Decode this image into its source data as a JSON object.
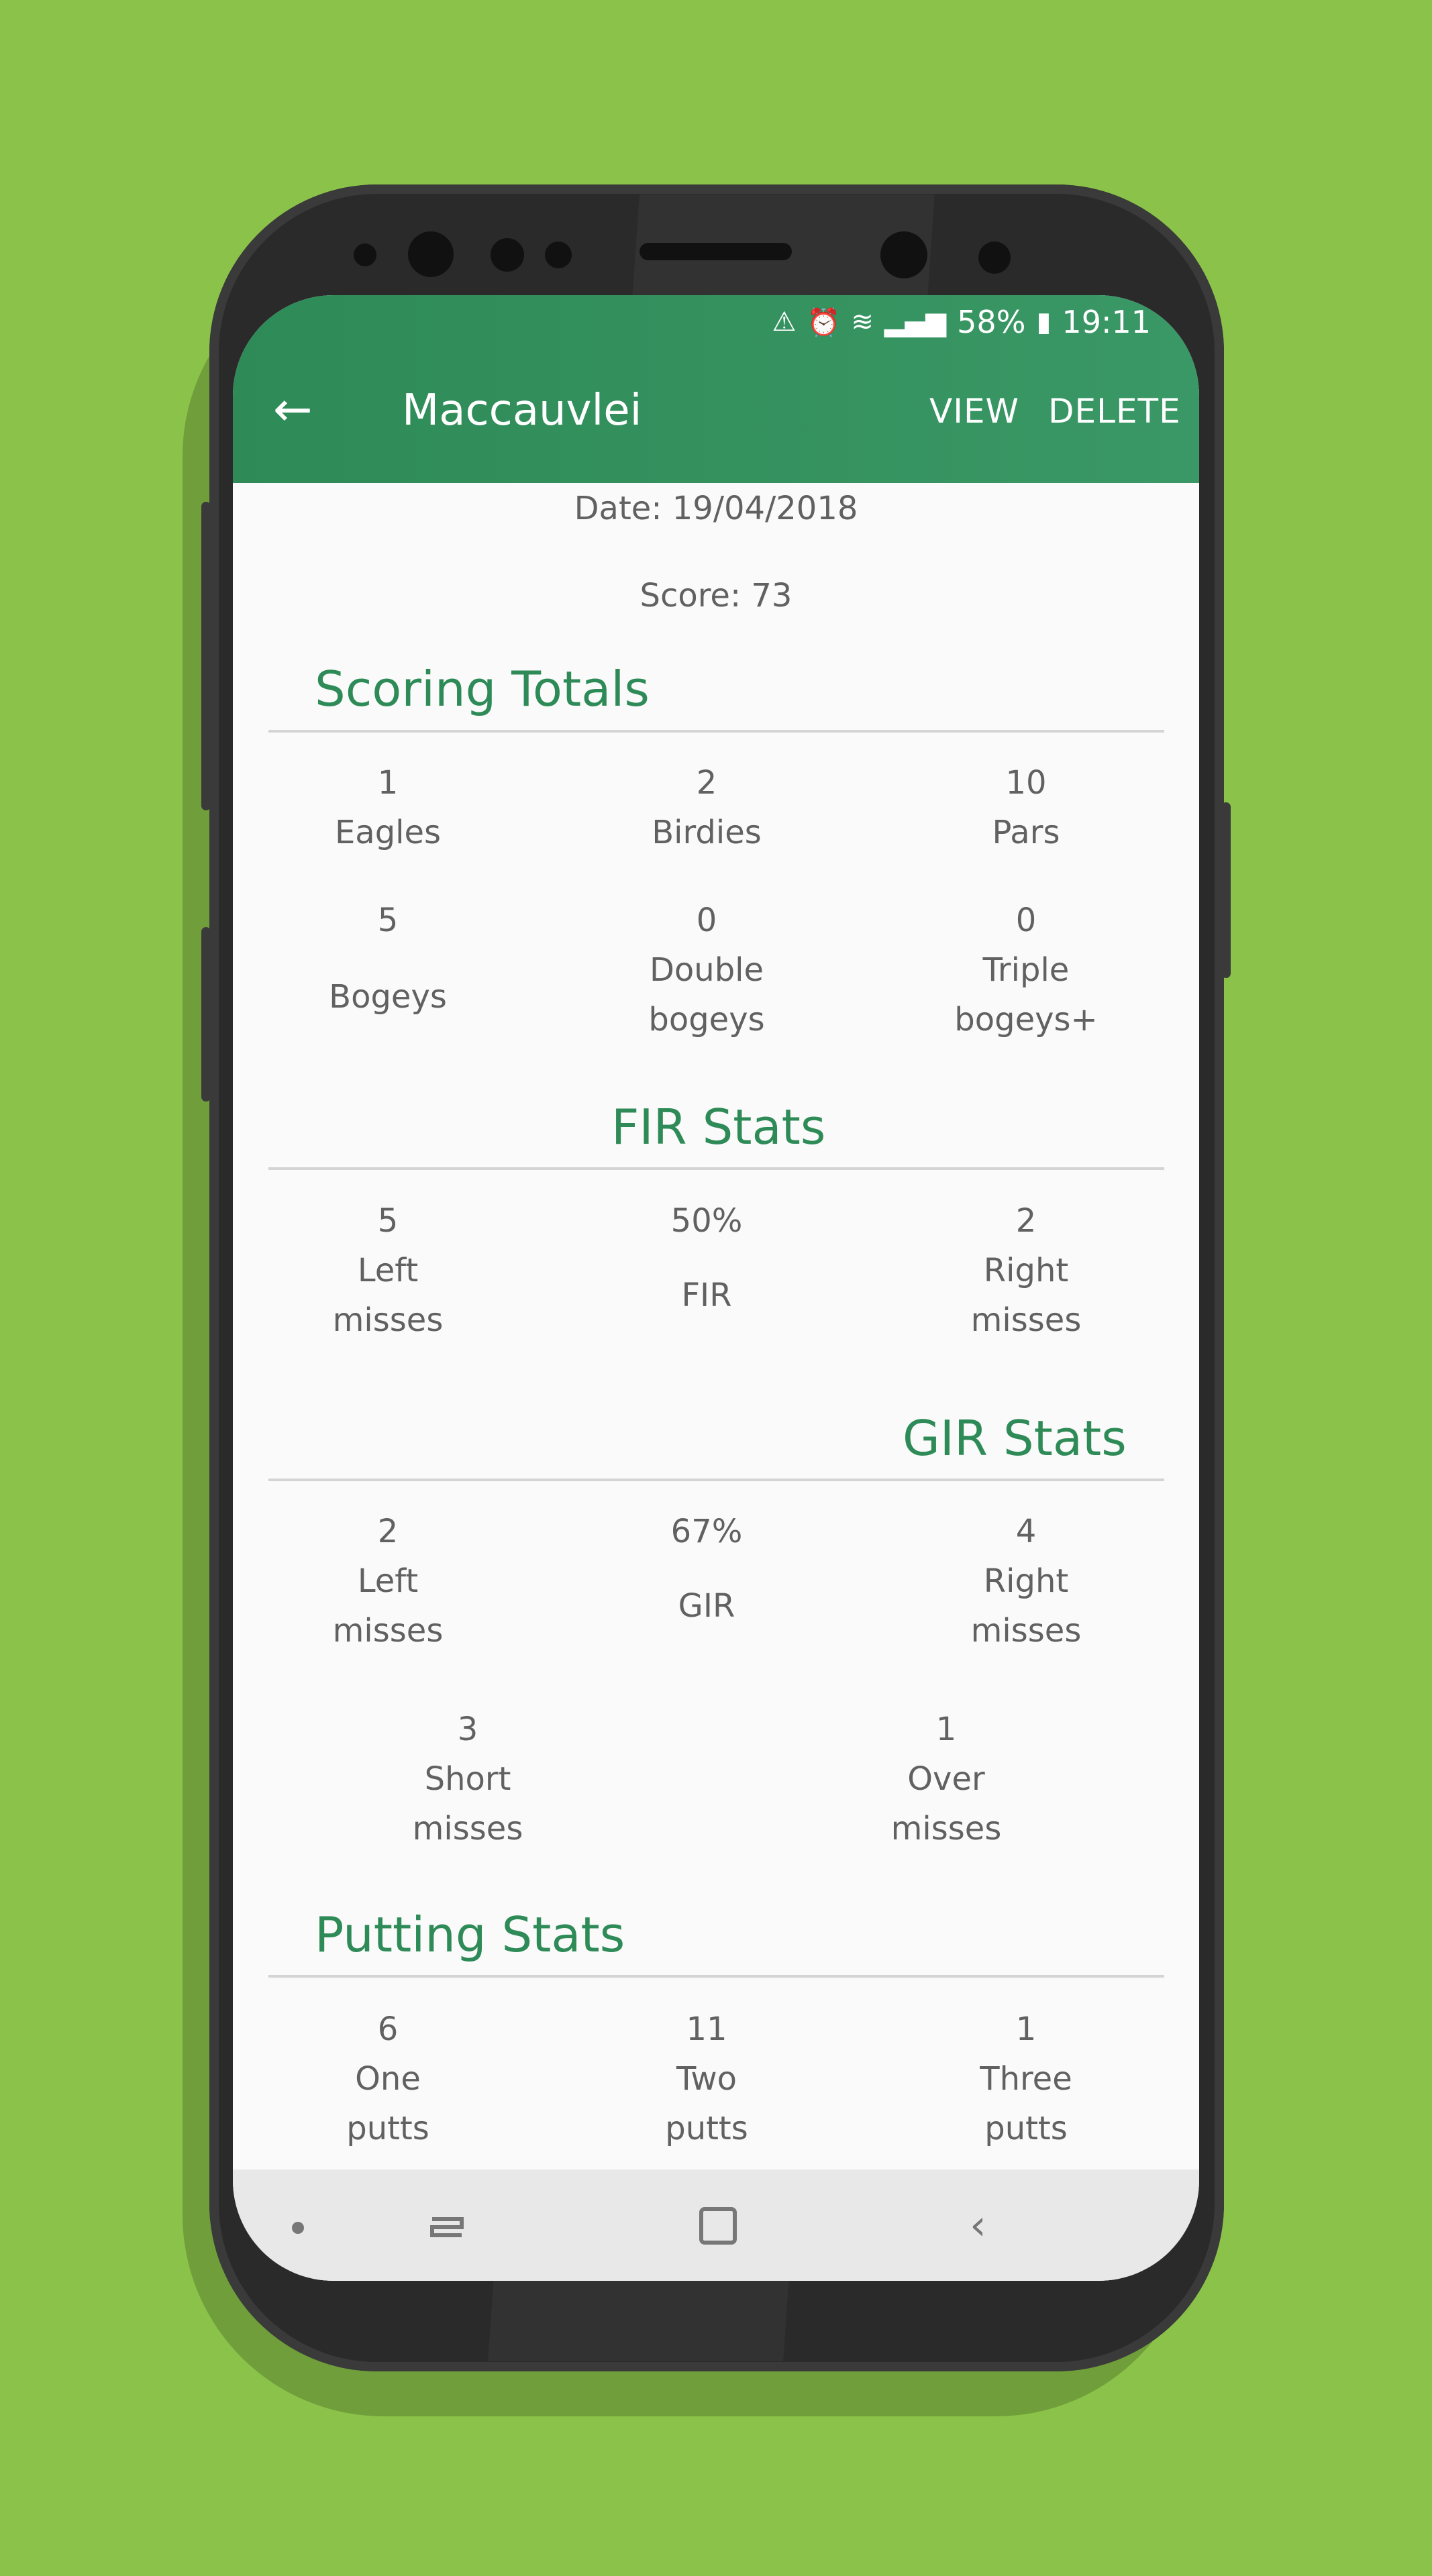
{
  "status_bar": {
    "battery": "58%",
    "time": "19:11"
  },
  "app_bar": {
    "title": "Maccauvlei",
    "view_label": "VIEW",
    "delete_label": "DELETE"
  },
  "round": {
    "date": "Date: 19/04/2018",
    "score": "Score: 73"
  },
  "scoring": {
    "title": "Scoring Totals",
    "items": [
      {
        "value": "1",
        "label": "Eagles"
      },
      {
        "value": "2",
        "label": "Birdies"
      },
      {
        "value": "10",
        "label": "Pars"
      },
      {
        "value": "5",
        "label": "Bogeys"
      },
      {
        "value": "0",
        "label": "Double\nbogeys"
      },
      {
        "value": "0",
        "label": "Triple\nbogeys+"
      }
    ]
  },
  "fir": {
    "title": "FIR Stats",
    "items": [
      {
        "value": "5",
        "label": "Left\nmisses"
      },
      {
        "value": "50%",
        "label": "FIR"
      },
      {
        "value": "2",
        "label": "Right\nmisses"
      }
    ]
  },
  "gir": {
    "title": "GIR Stats",
    "items": [
      {
        "value": "2",
        "label": "Left\nmisses"
      },
      {
        "value": "67%",
        "label": "GIR"
      },
      {
        "value": "4",
        "label": "Right\nmisses"
      },
      {
        "value": "3",
        "label": "Short\nmisses"
      },
      {
        "value": "1",
        "label": "Over\nmisses"
      }
    ]
  },
  "putting": {
    "title": "Putting Stats",
    "items": [
      {
        "value": "6",
        "label": "One\nputts"
      },
      {
        "value": "11",
        "label": "Two\nputts"
      },
      {
        "value": "1",
        "label": "Three\nputts"
      }
    ]
  },
  "colors": {
    "background": "#8bc34a",
    "primary": "#2e8b57",
    "text": "#616161"
  }
}
